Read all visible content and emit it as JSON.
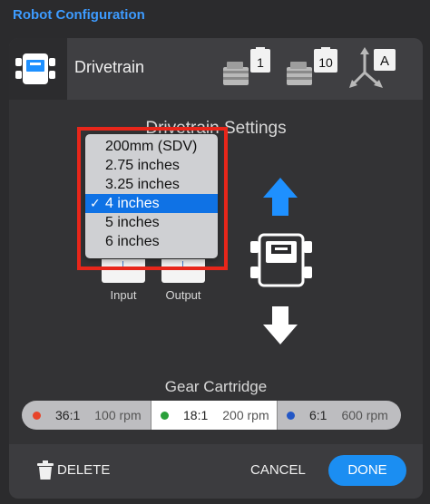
{
  "window": {
    "title": "Robot Configuration"
  },
  "header": {
    "device_label": "Drivetrain",
    "motor_port_1": "1",
    "motor_port_10": "10",
    "inertial_label": "A",
    "icons": [
      "brain-icon",
      "motor-icon",
      "motor-icon",
      "inertial-sensor-icon"
    ]
  },
  "settings": {
    "title": "Drivetrain Settings",
    "wheel_size_menu": {
      "options": [
        "200mm (SDV)",
        "2.75 inches",
        "3.25 inches",
        "4 inches",
        "5 inches",
        "6 inches"
      ],
      "selected": "4 inches",
      "check_mark": "✓"
    },
    "gear_ratio": {
      "input_label": "Input",
      "output_label": "Output"
    }
  },
  "gear_cartridge": {
    "title": "Gear Cartridge",
    "options": [
      {
        "ratio": "36:1",
        "rpm": "100 rpm",
        "color": "#e8442a"
      },
      {
        "ratio": "18:1",
        "rpm": "200 rpm",
        "color": "#2aa03a"
      },
      {
        "ratio": "6:1",
        "rpm": "600 rpm",
        "color": "#2357c6"
      }
    ],
    "selected": "18:1"
  },
  "footer": {
    "delete_label": "DELETE",
    "cancel_label": "CANCEL",
    "done_label": "DONE"
  },
  "colors": {
    "accent": "#3d9bff",
    "done_button": "#1b8ef2",
    "selection": "#0f72e5",
    "highlight_box": "#e8261a"
  }
}
